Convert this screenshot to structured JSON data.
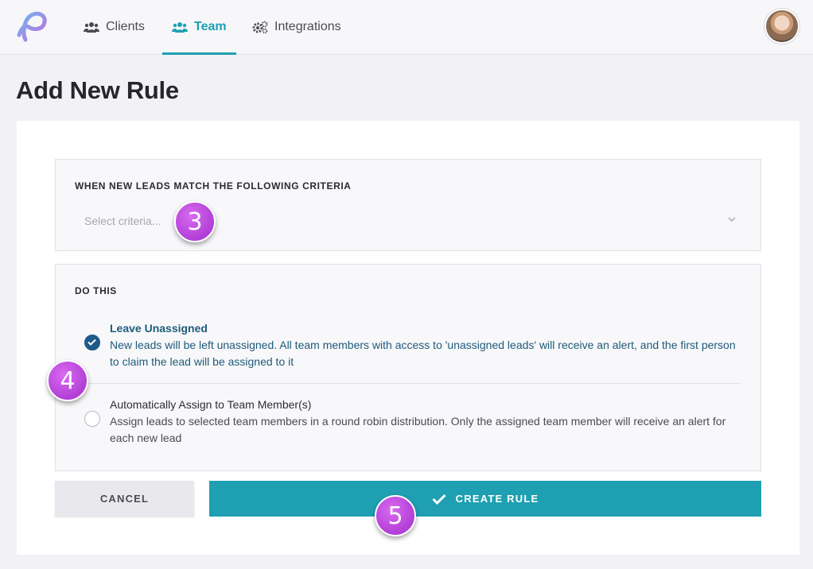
{
  "nav": {
    "tabs": [
      {
        "label": "Clients",
        "icon": "users-icon"
      },
      {
        "label": "Team",
        "icon": "users-icon",
        "active": true
      },
      {
        "label": "Integrations",
        "icon": "gears-icon"
      }
    ]
  },
  "page": {
    "title": "Add New Rule"
  },
  "criteria": {
    "heading": "WHEN NEW LEADS MATCH THE FOLLOWING CRITERIA",
    "placeholder": "Select criteria..."
  },
  "action": {
    "heading": "DO THIS",
    "options": [
      {
        "title": "Leave Unassigned",
        "description": "New leads will be left unassigned. All team members with access to 'unassigned leads' will receive an alert, and the first person to claim the lead will be assigned to it",
        "selected": true
      },
      {
        "title": "Automatically Assign to Team Member(s)",
        "description": "Assign leads to selected team members in a round robin distribution. Only the assigned team member will receive an alert for each new lead",
        "selected": false
      }
    ]
  },
  "buttons": {
    "cancel": "CANCEL",
    "create": "CREATE RULE"
  },
  "badges": {
    "b3": "3",
    "b4": "4",
    "b5": "5"
  },
  "colors": {
    "accent": "#1ea0b2",
    "selected": "#1e5a8a",
    "badge": "#c04fe0"
  }
}
